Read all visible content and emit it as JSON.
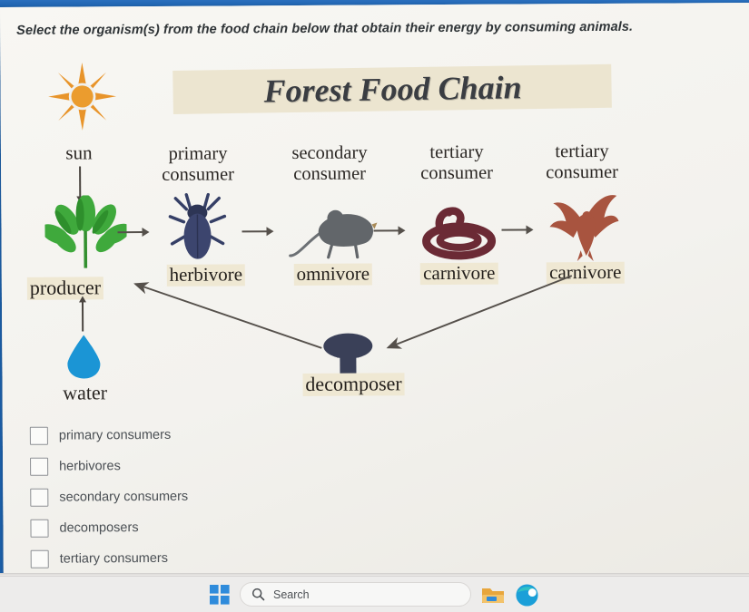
{
  "prompt": "Select the organism(s) from the food chain below that obtain their energy by consuming animals.",
  "diagram": {
    "title": "Forest Food Chain",
    "sun_label": "sun",
    "water_label": "water",
    "decomposer_label": "decomposer",
    "producer_label": "producer",
    "consumer_headers": [
      {
        "line1": "primary",
        "line2": "consumer"
      },
      {
        "line1": "secondary",
        "line2": "consumer"
      },
      {
        "line1": "tertiary",
        "line2": "consumer"
      },
      {
        "line1": "tertiary",
        "line2": "consumer"
      }
    ],
    "organism_labels": [
      "herbivore",
      "omnivore",
      "carnivore",
      "carnivore"
    ],
    "organism_icons": [
      "leaf-icon",
      "beetle-icon",
      "mouse-icon",
      "snake-icon",
      "eagle-icon"
    ],
    "icon_colors": {
      "sun": "#e8942a",
      "leaf": "#3fa93c",
      "beetle": "#353f66",
      "mouse": "#6c7074",
      "snake": "#6b2a35",
      "eagle": "#a8543f",
      "water": "#1b95d5",
      "mushroom": "#3a4058",
      "label_highlight": "#efe8d3",
      "title_plate": "#ece5d0"
    }
  },
  "options": [
    {
      "label": "primary consumers",
      "checked": false
    },
    {
      "label": "herbivores",
      "checked": false
    },
    {
      "label": "secondary consumers",
      "checked": false
    },
    {
      "label": "decomposers",
      "checked": false
    },
    {
      "label": "tertiary consumers",
      "checked": false
    }
  ],
  "taskbar": {
    "search_placeholder": "Search",
    "items": [
      "start-icon",
      "search-icon",
      "file-explorer-icon",
      "edge-browser-icon"
    ]
  }
}
